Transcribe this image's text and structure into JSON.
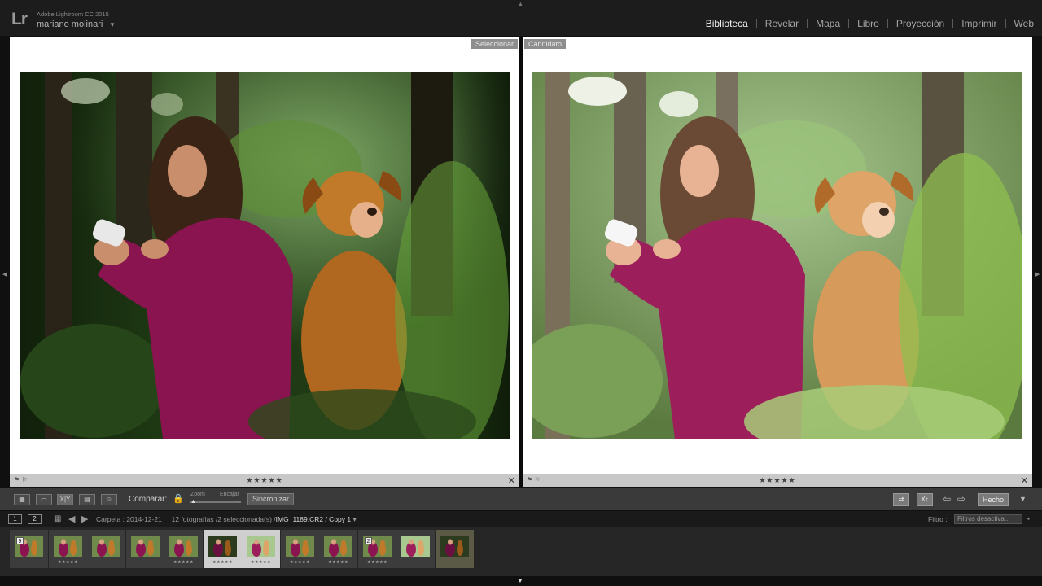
{
  "identity": {
    "logo": "Lr",
    "app_name": "Adobe Lightroom CC 2015",
    "user": "mariano molinari",
    "user_caret": "▼"
  },
  "modules": [
    {
      "label": "Biblioteca",
      "active": true
    },
    {
      "label": "Revelar",
      "active": false
    },
    {
      "label": "Mapa",
      "active": false
    },
    {
      "label": "Libro",
      "active": false
    },
    {
      "label": "Proyección",
      "active": false
    },
    {
      "label": "Imprimir",
      "active": false
    },
    {
      "label": "Web",
      "active": false
    }
  ],
  "compare": {
    "select_tag": "Seleccionar",
    "candidate_tag": "Candidato",
    "left_stars": "★★★★★",
    "right_stars": "★★★★★"
  },
  "toolbar": {
    "compare_label": "Comparar:",
    "zoom_label": "Zoom",
    "fit_label": "Encajar",
    "sync_label": "Sincronizar",
    "done_label": "Hecho",
    "view_xy": "X|Y"
  },
  "filmstrip_header": {
    "screen1": "1",
    "screen2": "2",
    "folder": "Carpeta : 2014-12-21",
    "count": "12 fotografías /2 seleccionada(s) /",
    "filename": "IMG_1189.CR2 / Copy 1",
    "filter_label": "Filtro :",
    "filter_value": "Filtros desactiva..."
  },
  "filmstrip": [
    {
      "badge": "9",
      "stars": "",
      "state": "normal",
      "tone": "warm"
    },
    {
      "badge": "",
      "stars": "★★★★★",
      "state": "normal",
      "tone": "warm"
    },
    {
      "badge": "",
      "stars": "",
      "state": "normal",
      "tone": "warm"
    },
    {
      "badge": "",
      "stars": "",
      "state": "normal",
      "tone": "warm"
    },
    {
      "badge": "",
      "stars": "★★★★★",
      "state": "normal",
      "tone": "warm"
    },
    {
      "badge": "",
      "stars": "★★★★★",
      "state": "selected",
      "tone": "dark"
    },
    {
      "badge": "",
      "stars": "★★★★★",
      "state": "selected",
      "tone": "bright"
    },
    {
      "badge": "",
      "stars": "★★★★★",
      "state": "normal",
      "tone": "warm"
    },
    {
      "badge": "",
      "stars": "★★★★★",
      "state": "normal",
      "tone": "warm"
    },
    {
      "badge": "2",
      "stars": "★★★★★",
      "state": "normal",
      "tone": "warm"
    },
    {
      "badge": "",
      "stars": "",
      "state": "normal",
      "tone": "bright"
    },
    {
      "badge": "",
      "stars": "",
      "state": "dim",
      "tone": "dark"
    }
  ],
  "colors": {
    "sweater": "#8a1450",
    "dog": "#c07a2a",
    "foliage_dark": "#1f3a14",
    "foliage_bright": "#8fbf4f"
  }
}
